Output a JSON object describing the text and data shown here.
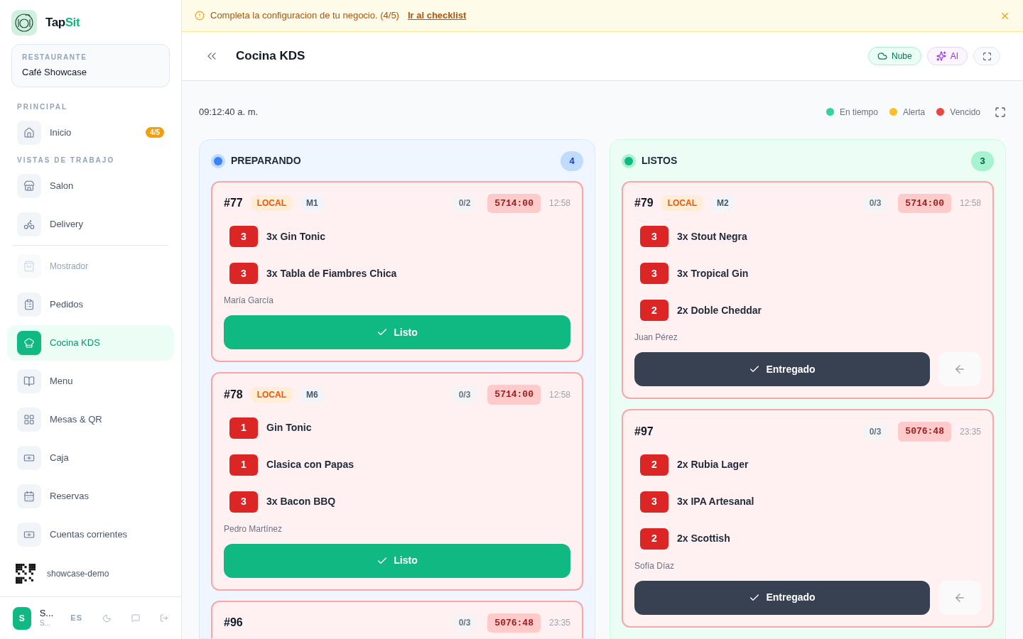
{
  "brand": {
    "name_first": "Tap",
    "name_second": "Sit"
  },
  "restaurant": {
    "label": "RESTAURANTE",
    "name": "Café Showcase"
  },
  "sidebar": {
    "sections": [
      {
        "heading": "PRINCIPAL",
        "groups": [
          [
            {
              "label": "Inicio",
              "badge": "4/5",
              "selected": false,
              "disabled": false
            }
          ]
        ]
      },
      {
        "heading": "VISTAS DE TRABAJO",
        "groups": [
          [
            {
              "label": "Salon",
              "selected": false,
              "disabled": false
            },
            {
              "label": "Delivery",
              "selected": false,
              "disabled": false
            }
          ],
          [
            {
              "label": "Mostrador",
              "selected": false,
              "disabled": true
            },
            {
              "label": "Pedidos",
              "selected": false,
              "disabled": false
            },
            {
              "label": "Cocina KDS",
              "selected": true,
              "disabled": false
            },
            {
              "label": "Menu",
              "selected": false,
              "disabled": false
            },
            {
              "label": "Mesas & QR",
              "selected": false,
              "disabled": false
            },
            {
              "label": "Caja",
              "selected": false,
              "disabled": false
            },
            {
              "label": "Reservas",
              "selected": false,
              "disabled": false
            },
            {
              "label": "Cuentas corrientes",
              "selected": false,
              "disabled": false
            }
          ]
        ]
      }
    ]
  },
  "qr": {
    "label": "showcase-demo"
  },
  "user": {
    "initial": "S",
    "name": "S...",
    "subtitle": "S...",
    "language": "ES"
  },
  "banner": {
    "text": "Completa la configuracion de tu negocio. (4/5)",
    "link": "Ir al checklist"
  },
  "header": {
    "title": "Cocina KDS",
    "buttons": [
      {
        "label": "Nube",
        "kind": "cloud"
      },
      {
        "label": "AI",
        "kind": "ai"
      }
    ]
  },
  "clock": "09:12:40 a. m.",
  "legend": [
    {
      "label": "En tiempo",
      "color": "#34d399"
    },
    {
      "label": "Alerta",
      "color": "#fbbf24"
    },
    {
      "label": "Vencido",
      "color": "#ef4444"
    }
  ],
  "columns": [
    {
      "title": "PREPARANDO",
      "count": "4",
      "kind": "preparing",
      "orders": [
        {
          "number": "#77",
          "kind": "overdue",
          "tags": [
            {
              "label": "LOCAL",
              "kind": "type"
            },
            {
              "label": "M1",
              "kind": "table"
            }
          ],
          "progress": "0/2",
          "timer": "5714:00",
          "time": "12:58",
          "items": [
            {
              "qty": "3",
              "label": "3x Gin Tonic"
            },
            {
              "qty": "3",
              "label": "3x Tabla de Fiambres Chica"
            }
          ],
          "customer": "María García",
          "action": {
            "label": "Listo",
            "kind": "ready"
          }
        },
        {
          "number": "#78",
          "kind": "overdue",
          "tags": [
            {
              "label": "LOCAL",
              "kind": "type"
            },
            {
              "label": "M6",
              "kind": "table"
            }
          ],
          "progress": "0/3",
          "timer": "5714:00",
          "time": "12:58",
          "items": [
            {
              "qty": "1",
              "label": "Gin Tonic"
            },
            {
              "qty": "1",
              "label": "Clasica con Papas"
            },
            {
              "qty": "3",
              "label": "3x Bacon BBQ"
            }
          ],
          "customer": "Pedro Martínez",
          "action": {
            "label": "Listo",
            "kind": "ready"
          }
        },
        {
          "number": "#96",
          "kind": "overdue",
          "progress": "0/3",
          "timer": "5076:48",
          "time": "23:35"
        }
      ]
    },
    {
      "title": "LISTOS",
      "count": "3",
      "kind": "ready",
      "orders": [
        {
          "number": "#79",
          "kind": "overdue",
          "tags": [
            {
              "label": "LOCAL",
              "kind": "type"
            },
            {
              "label": "M2",
              "kind": "table"
            }
          ],
          "progress": "0/3",
          "timer": "5714:00",
          "time": "12:58",
          "items": [
            {
              "qty": "3",
              "label": "3x Stout Negra"
            },
            {
              "qty": "3",
              "label": "3x Tropical Gin"
            },
            {
              "qty": "2",
              "label": "2x Doble Cheddar"
            }
          ],
          "customer": "Juan Pérez",
          "action": {
            "label": "Entregado",
            "kind": "deliver"
          },
          "back": true
        },
        {
          "number": "#97",
          "kind": "overdue",
          "progress": "0/3",
          "timer": "5076:48",
          "time": "23:35",
          "items": [
            {
              "qty": "2",
              "label": "2x Rubia Lager"
            },
            {
              "qty": "3",
              "label": "3x IPA Artesanal"
            },
            {
              "qty": "2",
              "label": "2x Scottish"
            }
          ],
          "customer": "Sofía Díaz",
          "action": {
            "label": "Entregado",
            "kind": "deliver"
          },
          "back": true
        }
      ]
    }
  ]
}
